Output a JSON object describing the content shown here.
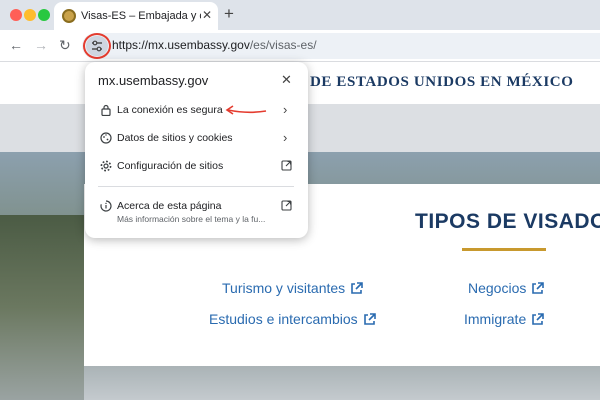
{
  "browser": {
    "tab_title": "Visas-ES – Embajada y consu",
    "url_origin": "https://mx.usembassy.gov",
    "url_path": "/es/visas-es/"
  },
  "page": {
    "header_title": "DE ESTADOS UNIDOS EN MÉXICO",
    "section_title": "TIPOS DE VISADO",
    "links": {
      "turismo": "Turismo y visitantes",
      "negocios": "Negocios",
      "estudios": "Estudios e intercambios",
      "immigrate": "Immigrate"
    },
    "accent_color": "#c8992e",
    "link_color": "#2a6bb0"
  },
  "site_info_popup": {
    "domain": "mx.usembassy.gov",
    "rows": {
      "connection": "La conexión es segura",
      "cookies": "Datos de sitios y cookies",
      "settings": "Configuración de sitios",
      "about": "Acerca de esta página",
      "about_sub": "Más información sobre el tema y la fu..."
    }
  },
  "icons": [
    "site-info-icon",
    "lock-icon",
    "cookie-icon",
    "gear-icon",
    "about-page-icon",
    "external-link-icon",
    "chevron-right-icon",
    "close-icon"
  ]
}
